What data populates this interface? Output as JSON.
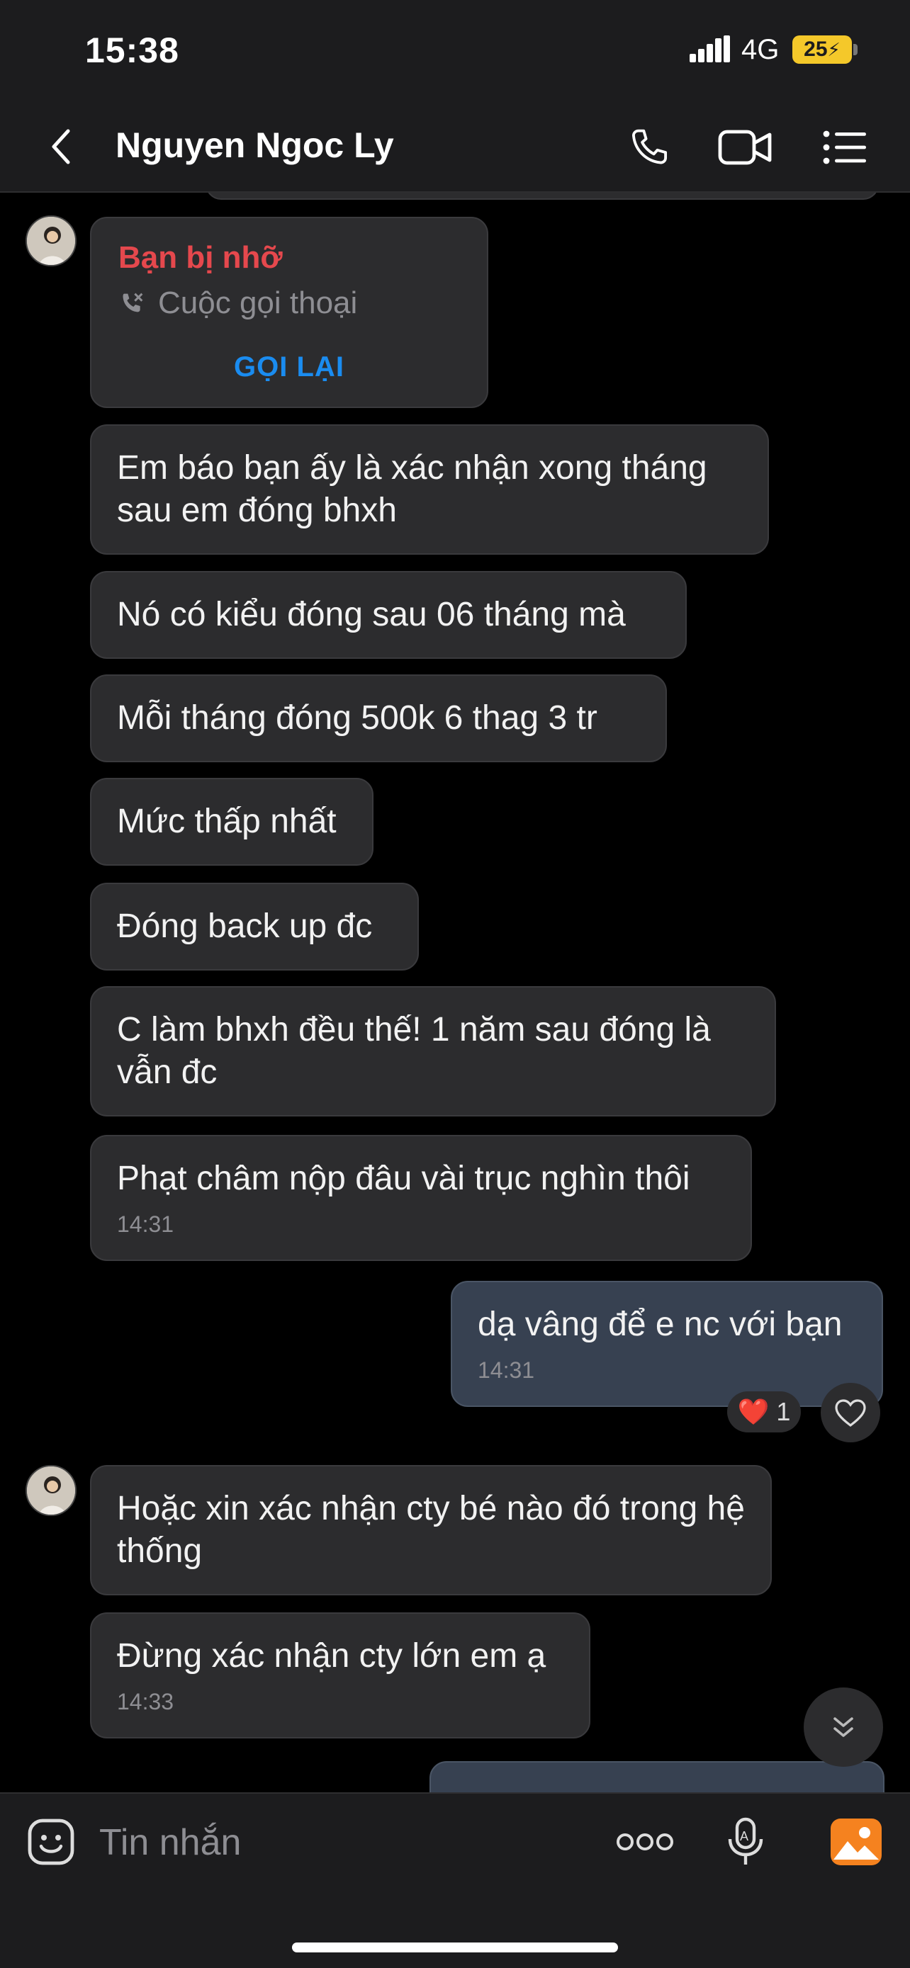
{
  "status_bar": {
    "time": "15:38",
    "network": "4G",
    "battery": "25"
  },
  "header": {
    "contact_name": "Nguyen Ngoc Ly",
    "icons": [
      "back-icon",
      "phone-icon",
      "video-call-icon",
      "menu-list-icon"
    ]
  },
  "missed_call": {
    "title": "Bạn bị nhỡ",
    "subtitle": "Cuộc gọi thoại",
    "action": "GỌI LẠI"
  },
  "messages": [
    {
      "from": "them",
      "text": "Em báo bạn ấy là xác nhận xong tháng sau em đóng bhxh"
    },
    {
      "from": "them",
      "text": "Nó có kiểu đóng sau 06 tháng mà"
    },
    {
      "from": "them",
      "text": "Mỗi tháng đóng 500k 6 thag 3 tr"
    },
    {
      "from": "them",
      "text": "Mức thấp nhất"
    },
    {
      "from": "them",
      "text": "Đóng back up đc"
    },
    {
      "from": "them",
      "text": "C làm bhxh đều thế! 1 năm sau đóng là vẫn đc"
    },
    {
      "from": "them",
      "text": "Phạt châm nộp đâu vài trục nghìn thôi",
      "time": "14:31"
    },
    {
      "from": "me",
      "text": "dạ vâng để e nc với bạn",
      "time": "14:31",
      "reaction": {
        "emoji": "❤️",
        "count": "1"
      }
    },
    {
      "from": "them",
      "text": "Hoặc xin xác nhận cty bé nào đó trong hệ thống"
    },
    {
      "from": "them",
      "text": "Đừng xác nhận cty lớn em ạ",
      "time": "14:33"
    }
  ],
  "composer": {
    "placeholder": "Tin nhắn",
    "icons": [
      "sticker-icon",
      "more-dots-icon",
      "voice-to-text-icon",
      "gallery-icon"
    ]
  },
  "colors": {
    "background": "#000000",
    "bar": "#1c1c1e",
    "incoming_bubble": "#2c2c2e",
    "outgoing_bubble": "#374151",
    "missed_red": "#e5484d",
    "call_back_blue": "#1a8cf0",
    "gallery_orange": "#f5821f",
    "battery_yellow": "#f4c82a"
  }
}
